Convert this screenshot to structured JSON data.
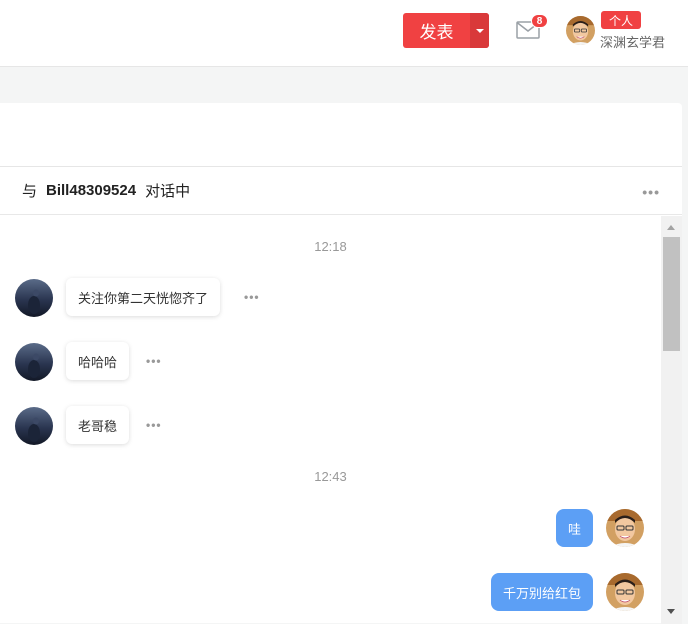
{
  "topbar": {
    "publish_label": "发表",
    "mail_count": "8",
    "profile_badge": "个人",
    "profile_name": "深渊玄学君"
  },
  "chat": {
    "header_prefix": "与",
    "partner_name": "Bill48309524",
    "header_suffix": "对话中",
    "more_label": "•••",
    "messages": [
      {
        "type": "timestamp",
        "text": "12:18"
      },
      {
        "type": "incoming",
        "text": "关注你第二天恍惚齐了"
      },
      {
        "type": "incoming",
        "text": "哈哈哈"
      },
      {
        "type": "incoming",
        "text": "老哥稳"
      },
      {
        "type": "timestamp",
        "text": "12:43"
      },
      {
        "type": "outgoing",
        "text": "哇"
      },
      {
        "type": "outgoing",
        "text": "千万别给红包"
      }
    ]
  },
  "colors": {
    "brand_red": "#f04142",
    "outgoing_bubble": "#5c9ff5"
  }
}
